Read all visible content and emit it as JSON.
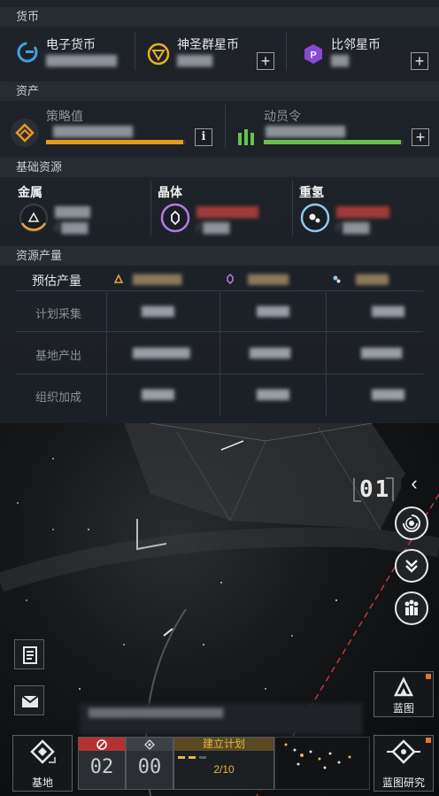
{
  "sections": {
    "currency": "货币",
    "assets": "资产",
    "basic_resources": "基础资源",
    "resource_output": "资源产量"
  },
  "currencies": [
    {
      "name": "电子货币",
      "icon": "e-currency-icon",
      "value": "▇▇▇▇▇▇▇▇"
    },
    {
      "name": "神圣群星币",
      "icon": "holy-star-coin-icon",
      "value": "▇▇▇▇",
      "plus": "+"
    },
    {
      "name": "比邻星币",
      "icon": "proxima-coin-icon",
      "value": "▇▇",
      "plus": "+"
    }
  ],
  "assets": [
    {
      "name": "策略值",
      "icon": "strategy-icon",
      "value": "▇▇▇▇▇▇▇▇▇",
      "fill": 0.98,
      "color": "#e69a1c",
      "button": "i"
    },
    {
      "name": "动员令",
      "icon": "mobilize-icon",
      "value": "▇▇▇▇▇▇▇▇▇",
      "fill": 0.98,
      "color": "#67c24a",
      "button": "+"
    }
  ],
  "resources": [
    {
      "name": "金属",
      "icon": "metal-icon",
      "color": "#e3a63a",
      "value": "▇▇▇▇",
      "sub": "/ ▇▇▇"
    },
    {
      "name": "晶体",
      "icon": "crystal-icon",
      "color": "#b27ce8",
      "value": "▇▇▇▇▇▇▇",
      "sub": "/ ▇▇▇"
    },
    {
      "name": "重氢",
      "icon": "deuterium-icon",
      "color": "#8cc9ee",
      "value": "▇▇▇▇▇▇",
      "sub": "/ ▇▇▇"
    }
  ],
  "output": {
    "estimated_label": "预估产量",
    "rows": [
      {
        "label": "计划采集",
        "values": [
          "▇▇▇▇",
          "▇▇▇▇",
          "▇▇▇▇"
        ]
      },
      {
        "label": "基地产出",
        "values": [
          "▇▇▇▇▇▇▇",
          "▇▇▇▇▇",
          "▇▇▇▇▇"
        ]
      },
      {
        "label": "组织加成",
        "values": [
          "▇▇▇▇",
          "▇▇▇▇",
          "▇▇▇▇"
        ]
      }
    ],
    "estimated_values": [
      "▇▇▇▇▇▇",
      "▇▇▇▇▇",
      "▇▇▇▇"
    ]
  },
  "map": {
    "sector_label": "01",
    "collapse": "‹"
  },
  "bottom": {
    "base_label": "基地",
    "blueprint_label": "蓝图",
    "blueprint_research_label": "蓝图研究",
    "plan_label": "建立计划",
    "plan_progress": "2/10",
    "count_a": "02",
    "count_b": "00",
    "ticker": "▇▇▇▇▇▇▇▇▇▇▇▇▇▇▇▇▇▇"
  },
  "colors": {
    "orange": "#e69a1c",
    "green": "#67c24a",
    "purple": "#b27ce8",
    "cyan": "#8cc9ee",
    "red_dash": "#c23a3a"
  }
}
